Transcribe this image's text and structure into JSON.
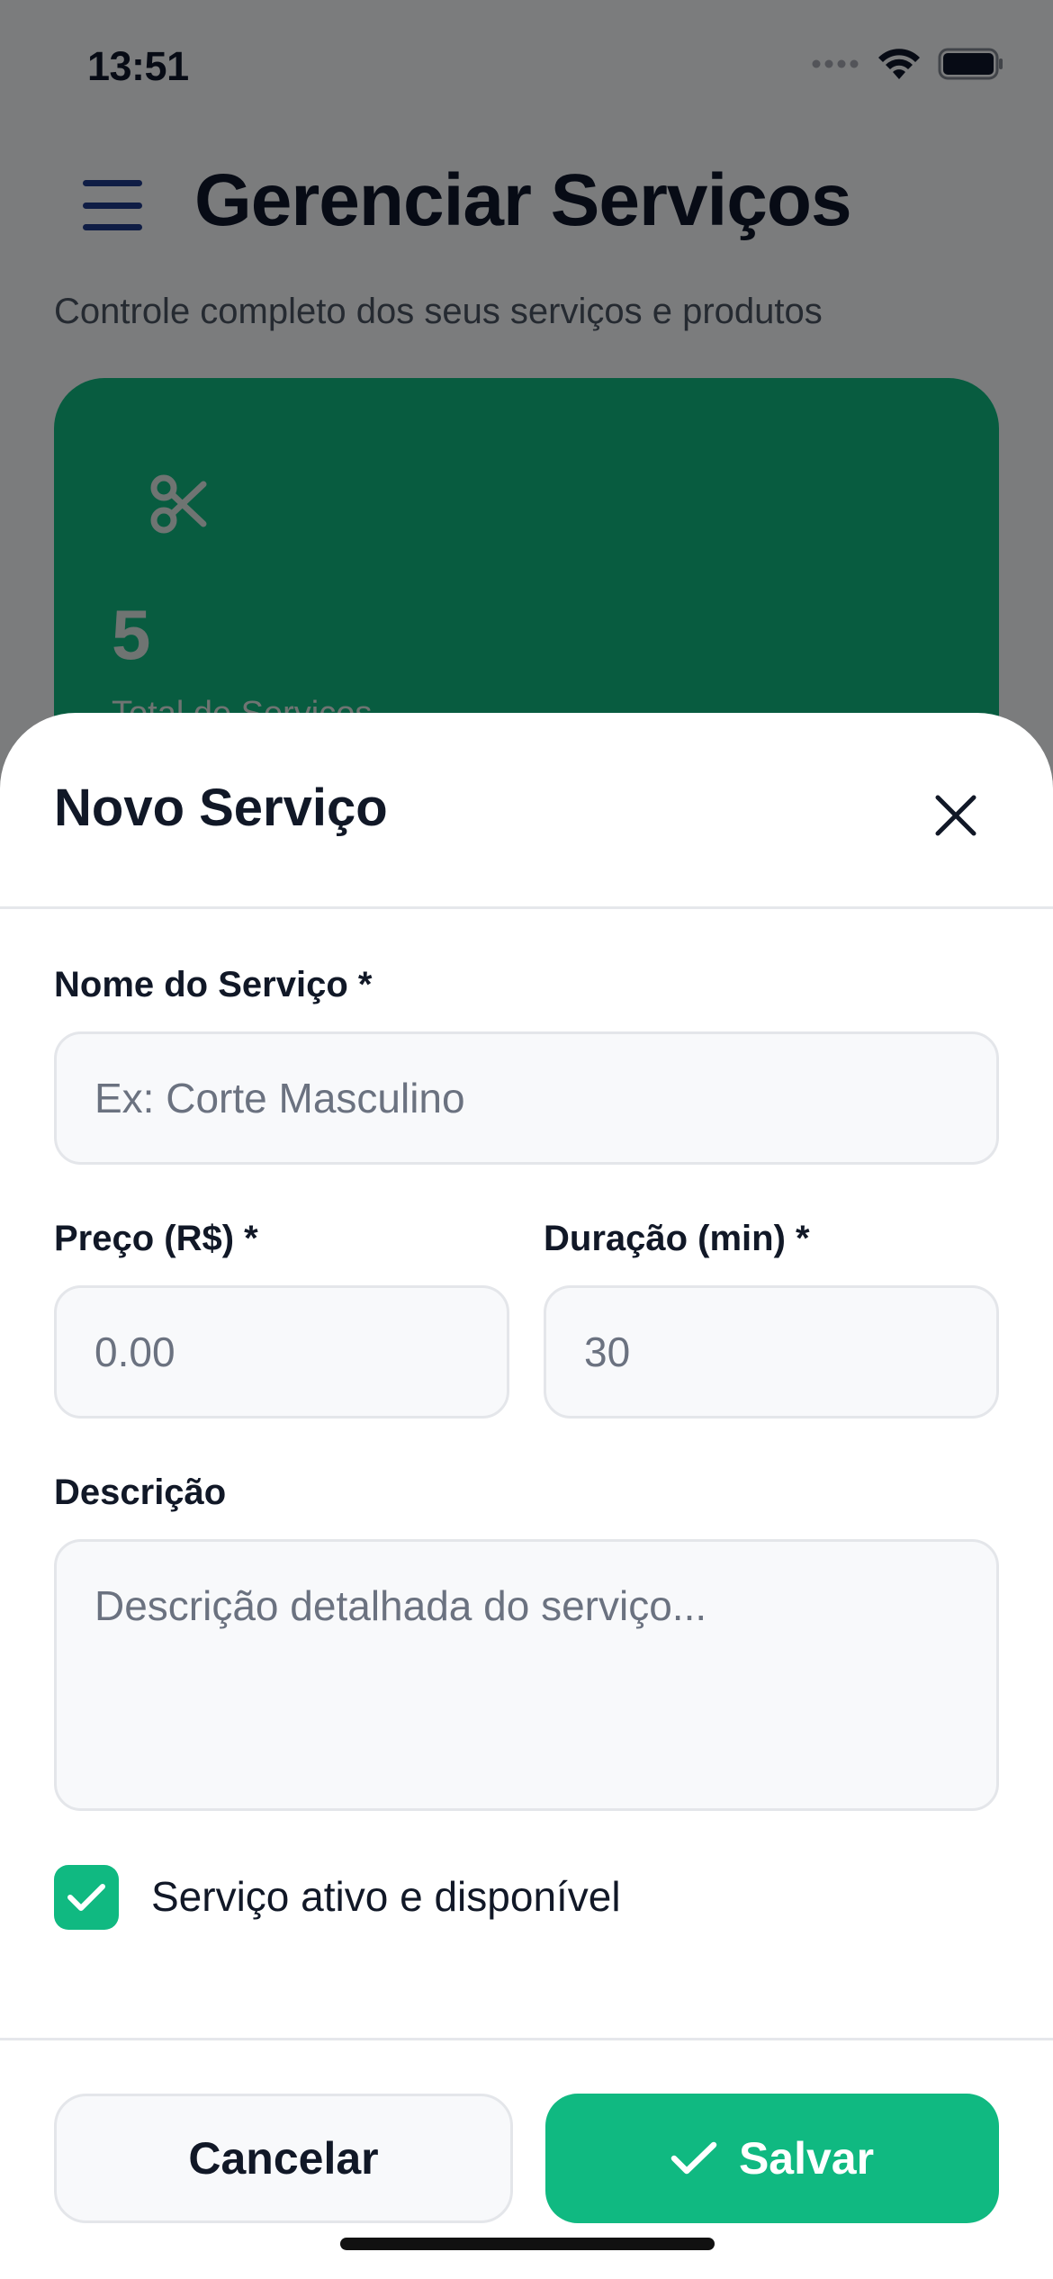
{
  "status_bar": {
    "time": "13:51"
  },
  "page": {
    "title": "Gerenciar Serviços",
    "subtitle": "Controle completo dos seus serviços e produtos",
    "stat_card": {
      "value": "5",
      "label": "Total de Serviços",
      "icon": "scissors-icon",
      "color": "#10b981"
    }
  },
  "modal": {
    "title": "Novo Serviço",
    "fields": {
      "name": {
        "label": "Nome do Serviço *",
        "placeholder": "Ex: Corte Masculino",
        "value": ""
      },
      "price": {
        "label": "Preço (R$) *",
        "placeholder": "0.00",
        "value": ""
      },
      "duration": {
        "label": "Duração (min) *",
        "placeholder": "30",
        "value": ""
      },
      "description": {
        "label": "Descrição",
        "placeholder": "Descrição detalhada do serviço...",
        "value": ""
      }
    },
    "active_checkbox": {
      "label": "Serviço ativo e disponível",
      "checked": true
    },
    "buttons": {
      "cancel": "Cancelar",
      "save": "Salvar"
    },
    "accent_color": "#10b981"
  }
}
